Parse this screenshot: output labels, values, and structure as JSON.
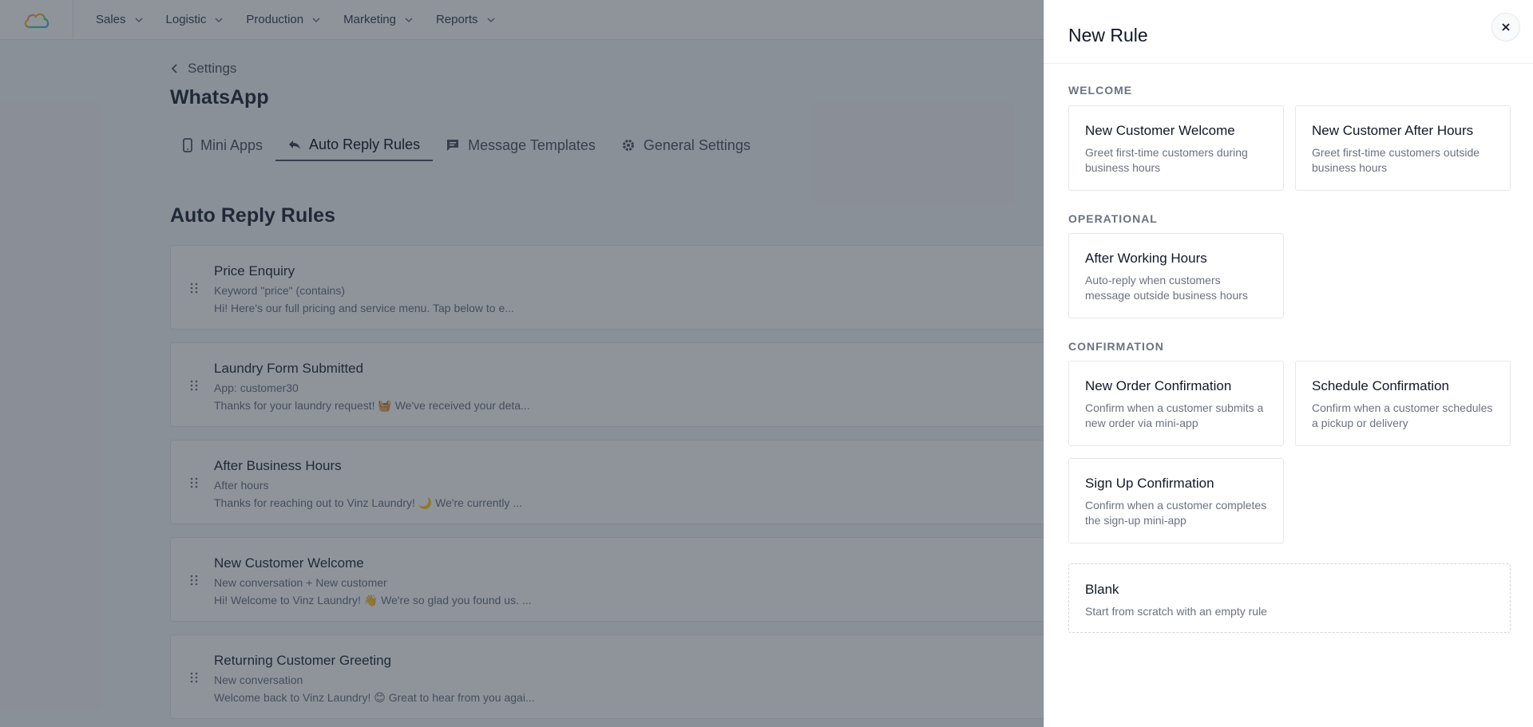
{
  "nav": {
    "items": [
      {
        "label": "Sales"
      },
      {
        "label": "Logistic"
      },
      {
        "label": "Production"
      },
      {
        "label": "Marketing"
      },
      {
        "label": "Reports"
      }
    ]
  },
  "page": {
    "breadcrumb": "Settings",
    "title": "WhatsApp",
    "tabs": [
      {
        "label": "Mini Apps",
        "icon": "mobile-icon"
      },
      {
        "label": "Auto Reply Rules",
        "icon": "reply-icon"
      },
      {
        "label": "Message Templates",
        "icon": "message-icon"
      },
      {
        "label": "General Settings",
        "icon": "gear-icon"
      }
    ],
    "section_title": "Auto Reply Rules",
    "rules": [
      {
        "name": "Price Enquiry",
        "trigger": "Keyword \"price\" (contains)",
        "preview": "Hi! Here's our full pricing and service menu. Tap below to e..."
      },
      {
        "name": "Laundry Form Submitted",
        "trigger": "App: customer30",
        "preview": "Thanks for your laundry request! 🧺 We've received your deta..."
      },
      {
        "name": "After Business Hours",
        "trigger": "After hours",
        "preview": "Thanks for reaching out to Vinz Laundry! 🌙 We're currently ..."
      },
      {
        "name": "New Customer Welcome",
        "trigger": "New conversation + New customer",
        "preview": "Hi! Welcome to Vinz Laundry! 👋 We're so glad you found us. ..."
      },
      {
        "name": "Returning Customer Greeting",
        "trigger": "New conversation",
        "preview": "Welcome back to Vinz Laundry! 😊 Great to hear from you agai..."
      }
    ]
  },
  "drawer": {
    "title": "New Rule",
    "groups": {
      "welcome": "WELCOME",
      "operational": "OPERATIONAL",
      "confirmation": "CONFIRMATION"
    },
    "templates": {
      "new_customer_welcome": {
        "name": "New Customer Welcome",
        "desc": "Greet first-time customers during business hours"
      },
      "new_customer_after_hours": {
        "name": "New Customer After Hours",
        "desc": "Greet first-time customers outside business hours"
      },
      "after_working_hours": {
        "name": "After Working Hours",
        "desc": "Auto-reply when customers message outside business hours"
      },
      "new_order_confirmation": {
        "name": "New Order Confirmation",
        "desc": "Confirm when a customer submits a new order via mini-app"
      },
      "schedule_confirmation": {
        "name": "Schedule Confirmation",
        "desc": "Confirm when a customer schedules a pickup or delivery"
      },
      "sign_up_confirmation": {
        "name": "Sign Up Confirmation",
        "desc": "Confirm when a customer completes the sign-up mini-app"
      },
      "blank": {
        "name": "Blank",
        "desc": "Start from scratch with an empty rule"
      }
    }
  }
}
